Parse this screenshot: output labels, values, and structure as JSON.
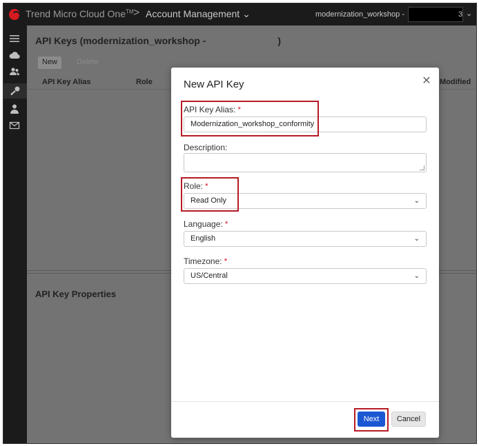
{
  "topbar": {
    "brand": "Trend Micro Cloud One",
    "brand_tm": "TM",
    "separator": ">",
    "crumb": "Account Management",
    "account": "modernization_workshop -",
    "account_tail": "3"
  },
  "main": {
    "title": "API Keys (modernization_workshop -",
    "title_close": ")",
    "toolbar": {
      "new_label": "New",
      "delete_label": "Delete"
    },
    "columns": [
      "API Key Alias",
      "Role",
      "Modified"
    ],
    "properties_title": "API Key Properties"
  },
  "modal": {
    "title": "New API Key",
    "required_mark": "*",
    "alias": {
      "label": "API Key Alias:",
      "value": "Modernization_workshop_conformity"
    },
    "description": {
      "label": "Description:",
      "value": ""
    },
    "role": {
      "label": "Role:",
      "value": "Read Only"
    },
    "language": {
      "label": "Language:",
      "value": "English"
    },
    "timezone": {
      "label": "Timezone:",
      "value": "US/Central"
    },
    "next_label": "Next",
    "cancel_label": "Cancel"
  },
  "icons": {
    "close": "close-icon",
    "menu": "menu-icon",
    "cloud": "cloud-icon",
    "users": "users-icon",
    "key": "key-icon",
    "user": "user-icon",
    "mail": "mail-icon"
  },
  "colors": {
    "primary_button": "#1b57d3",
    "required": "#d9232e",
    "highlight": "#b51a24",
    "brand_red": "#d71920"
  }
}
